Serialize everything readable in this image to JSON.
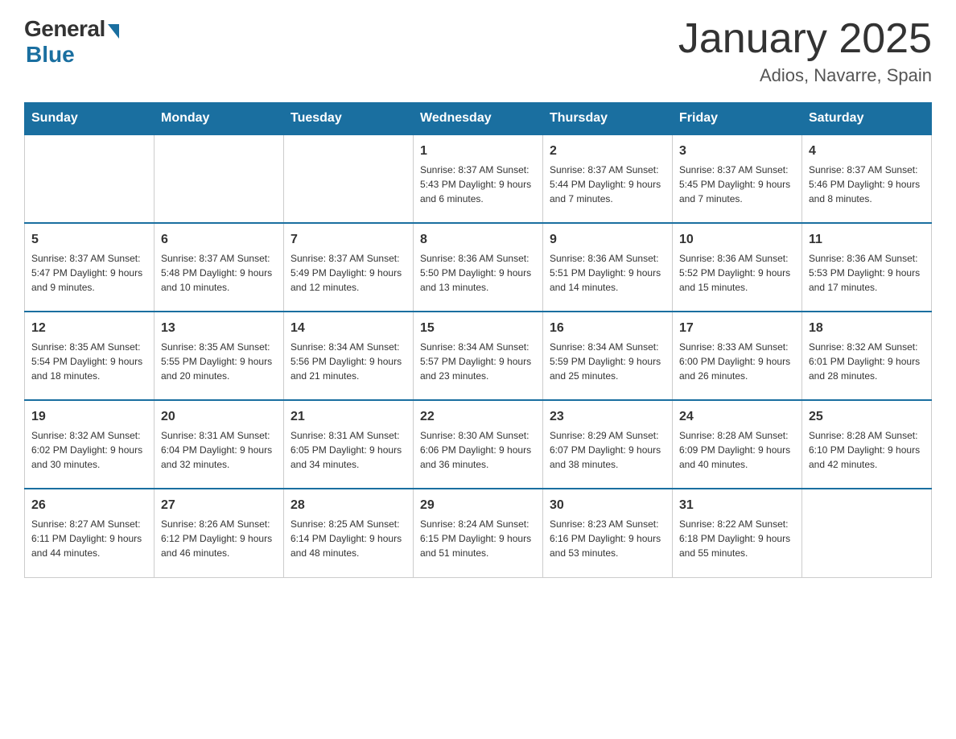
{
  "header": {
    "logo_general": "General",
    "logo_blue": "Blue",
    "month_title": "January 2025",
    "location": "Adios, Navarre, Spain"
  },
  "days_of_week": [
    "Sunday",
    "Monday",
    "Tuesday",
    "Wednesday",
    "Thursday",
    "Friday",
    "Saturday"
  ],
  "weeks": [
    [
      {
        "day": "",
        "info": ""
      },
      {
        "day": "",
        "info": ""
      },
      {
        "day": "",
        "info": ""
      },
      {
        "day": "1",
        "info": "Sunrise: 8:37 AM\nSunset: 5:43 PM\nDaylight: 9 hours and 6 minutes."
      },
      {
        "day": "2",
        "info": "Sunrise: 8:37 AM\nSunset: 5:44 PM\nDaylight: 9 hours and 7 minutes."
      },
      {
        "day": "3",
        "info": "Sunrise: 8:37 AM\nSunset: 5:45 PM\nDaylight: 9 hours and 7 minutes."
      },
      {
        "day": "4",
        "info": "Sunrise: 8:37 AM\nSunset: 5:46 PM\nDaylight: 9 hours and 8 minutes."
      }
    ],
    [
      {
        "day": "5",
        "info": "Sunrise: 8:37 AM\nSunset: 5:47 PM\nDaylight: 9 hours and 9 minutes."
      },
      {
        "day": "6",
        "info": "Sunrise: 8:37 AM\nSunset: 5:48 PM\nDaylight: 9 hours and 10 minutes."
      },
      {
        "day": "7",
        "info": "Sunrise: 8:37 AM\nSunset: 5:49 PM\nDaylight: 9 hours and 12 minutes."
      },
      {
        "day": "8",
        "info": "Sunrise: 8:36 AM\nSunset: 5:50 PM\nDaylight: 9 hours and 13 minutes."
      },
      {
        "day": "9",
        "info": "Sunrise: 8:36 AM\nSunset: 5:51 PM\nDaylight: 9 hours and 14 minutes."
      },
      {
        "day": "10",
        "info": "Sunrise: 8:36 AM\nSunset: 5:52 PM\nDaylight: 9 hours and 15 minutes."
      },
      {
        "day": "11",
        "info": "Sunrise: 8:36 AM\nSunset: 5:53 PM\nDaylight: 9 hours and 17 minutes."
      }
    ],
    [
      {
        "day": "12",
        "info": "Sunrise: 8:35 AM\nSunset: 5:54 PM\nDaylight: 9 hours and 18 minutes."
      },
      {
        "day": "13",
        "info": "Sunrise: 8:35 AM\nSunset: 5:55 PM\nDaylight: 9 hours and 20 minutes."
      },
      {
        "day": "14",
        "info": "Sunrise: 8:34 AM\nSunset: 5:56 PM\nDaylight: 9 hours and 21 minutes."
      },
      {
        "day": "15",
        "info": "Sunrise: 8:34 AM\nSunset: 5:57 PM\nDaylight: 9 hours and 23 minutes."
      },
      {
        "day": "16",
        "info": "Sunrise: 8:34 AM\nSunset: 5:59 PM\nDaylight: 9 hours and 25 minutes."
      },
      {
        "day": "17",
        "info": "Sunrise: 8:33 AM\nSunset: 6:00 PM\nDaylight: 9 hours and 26 minutes."
      },
      {
        "day": "18",
        "info": "Sunrise: 8:32 AM\nSunset: 6:01 PM\nDaylight: 9 hours and 28 minutes."
      }
    ],
    [
      {
        "day": "19",
        "info": "Sunrise: 8:32 AM\nSunset: 6:02 PM\nDaylight: 9 hours and 30 minutes."
      },
      {
        "day": "20",
        "info": "Sunrise: 8:31 AM\nSunset: 6:04 PM\nDaylight: 9 hours and 32 minutes."
      },
      {
        "day": "21",
        "info": "Sunrise: 8:31 AM\nSunset: 6:05 PM\nDaylight: 9 hours and 34 minutes."
      },
      {
        "day": "22",
        "info": "Sunrise: 8:30 AM\nSunset: 6:06 PM\nDaylight: 9 hours and 36 minutes."
      },
      {
        "day": "23",
        "info": "Sunrise: 8:29 AM\nSunset: 6:07 PM\nDaylight: 9 hours and 38 minutes."
      },
      {
        "day": "24",
        "info": "Sunrise: 8:28 AM\nSunset: 6:09 PM\nDaylight: 9 hours and 40 minutes."
      },
      {
        "day": "25",
        "info": "Sunrise: 8:28 AM\nSunset: 6:10 PM\nDaylight: 9 hours and 42 minutes."
      }
    ],
    [
      {
        "day": "26",
        "info": "Sunrise: 8:27 AM\nSunset: 6:11 PM\nDaylight: 9 hours and 44 minutes."
      },
      {
        "day": "27",
        "info": "Sunrise: 8:26 AM\nSunset: 6:12 PM\nDaylight: 9 hours and 46 minutes."
      },
      {
        "day": "28",
        "info": "Sunrise: 8:25 AM\nSunset: 6:14 PM\nDaylight: 9 hours and 48 minutes."
      },
      {
        "day": "29",
        "info": "Sunrise: 8:24 AM\nSunset: 6:15 PM\nDaylight: 9 hours and 51 minutes."
      },
      {
        "day": "30",
        "info": "Sunrise: 8:23 AM\nSunset: 6:16 PM\nDaylight: 9 hours and 53 minutes."
      },
      {
        "day": "31",
        "info": "Sunrise: 8:22 AM\nSunset: 6:18 PM\nDaylight: 9 hours and 55 minutes."
      },
      {
        "day": "",
        "info": ""
      }
    ]
  ]
}
